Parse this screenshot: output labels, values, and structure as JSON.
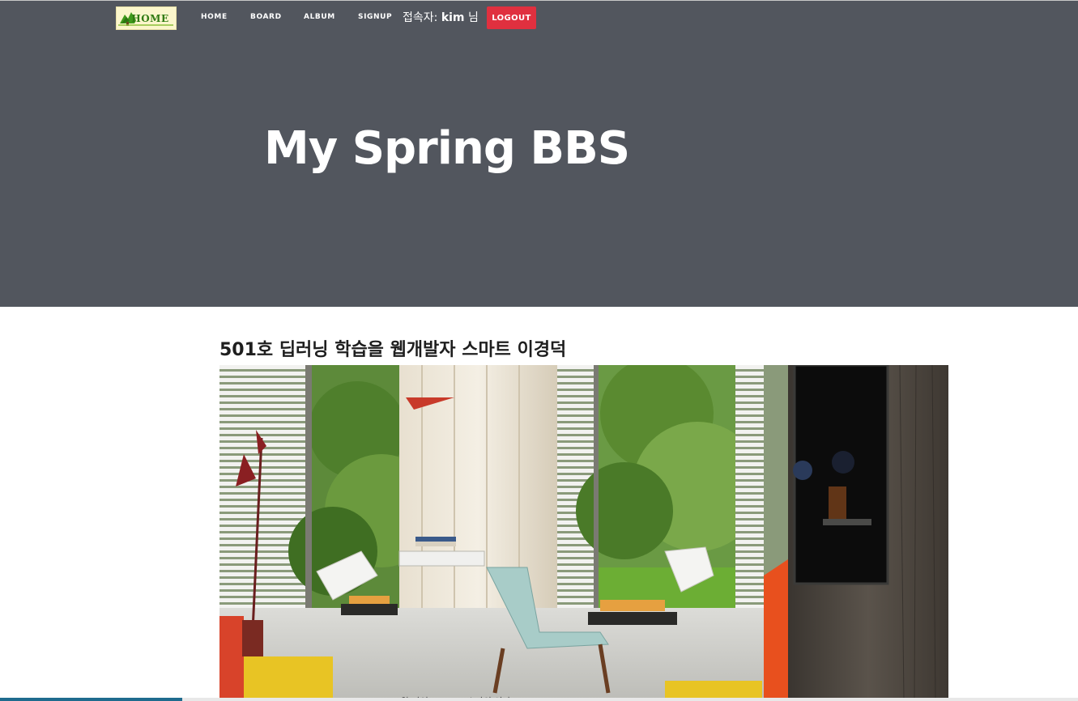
{
  "nav": {
    "logo_text": "HOME",
    "links": [
      {
        "label": "HOME"
      },
      {
        "label": "BOARD"
      },
      {
        "label": "ALBUM"
      },
      {
        "label": "SIGNUP"
      }
    ],
    "user_prefix": "접속자: ",
    "user_name": "kim",
    "user_suffix": " 님",
    "logout_label": "LOGOUT"
  },
  "hero": {
    "title": "My Spring BBS"
  },
  "post": {
    "title": "501호 딥러닝 학습을 웹개발자 스마트 이경덕",
    "caption": "알 과인  eeeeee  소다의 이다"
  },
  "colors": {
    "hero_bg": "#52565e",
    "logout_bg": "#e0303f",
    "scroll_thumb": "#1f6b8e"
  },
  "icons": {
    "logo": "tree-home-logo-icon"
  }
}
